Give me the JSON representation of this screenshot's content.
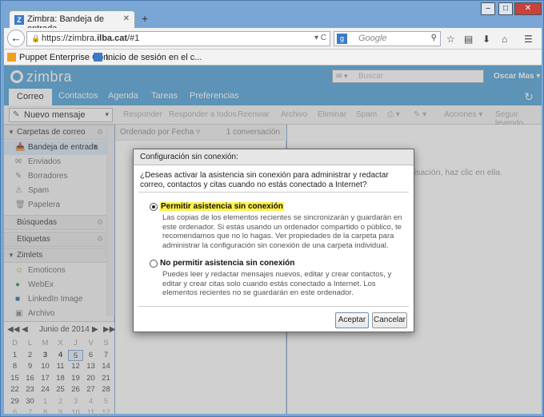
{
  "browser": {
    "tab_title": "Zimbra: Bandeja de entrada",
    "tab_close": "✕",
    "new_tab": "+",
    "url_prefix": "https://zimbra.",
    "url_domain": "ilba.cat",
    "url_suffix": "/#1",
    "url_controls": "▾ C",
    "search_placeholder": "Google",
    "window_controls": [
      "–",
      "□",
      "✕"
    ],
    "bookmarks": [
      "Puppet Enterprise Con...",
      "Inicio de sesión en el c..."
    ]
  },
  "zimbra": {
    "logo": "zimbra",
    "search_placeholder": "Buscar",
    "user": "Oscar Mas",
    "user_caret": "▾",
    "app_tabs": [
      "Correo",
      "Contactos",
      "Agenda",
      "Tareas",
      "Preferencias"
    ],
    "toolbar": {
      "new_message": "Nuevo mensaje",
      "actions": [
        "Responder",
        "Responder a todos",
        "Reenviar",
        "Archivo",
        "Eliminar",
        "Spam",
        "Acciones",
        "Seguir leyendo"
      ]
    },
    "sections": {
      "mail_folders": "Carpetas de correo",
      "searches": "Búsquedas",
      "tags": "Etiquetas",
      "zimlets": "Zimlets"
    },
    "folders": [
      "Bandeja de entrada",
      "Enviados",
      "Borradores",
      "Spam",
      "Papelera"
    ],
    "zimlets": [
      "Emoticons",
      "WebEx",
      "LinkedIn Image",
      "Archivo"
    ],
    "list": {
      "sort_label": "Ordenado por Fecha",
      "count": "1 conversación"
    },
    "reading_hint": "...isación, haz clic en ella."
  },
  "calendar": {
    "month": "Junio de 2014",
    "weekdays": [
      "D",
      "L",
      "M",
      "X",
      "J",
      "V",
      "S"
    ],
    "weeks": [
      [
        "1",
        "2",
        "3",
        "4",
        "5",
        "6",
        "7"
      ],
      [
        "8",
        "9",
        "10",
        "11",
        "12",
        "13",
        "14"
      ],
      [
        "15",
        "16",
        "17",
        "18",
        "19",
        "20",
        "21"
      ],
      [
        "22",
        "23",
        "24",
        "25",
        "26",
        "27",
        "28"
      ],
      [
        "29",
        "30",
        "1",
        "2",
        "3",
        "4",
        "5"
      ],
      [
        "6",
        "7",
        "8",
        "9",
        "10",
        "11",
        "12"
      ]
    ]
  },
  "dialog": {
    "title": "Configuración sin conexión:",
    "question": "¿Deseas activar la asistencia sin conexión para administrar y redactar correo, contactos y citas cuando no estás conectado a Internet?",
    "option_on": {
      "label": "Permitir asistencia sin conexión",
      "description": "Las copias de los elementos recientes se sincronizarán y guardarán en este ordenador. Si estás usando un ordenador compartido o público, te recomendamos que no lo hagas. Ver propiedades de la carpeta para administrar la configuración sin conexión de una carpeta individual."
    },
    "option_off": {
      "label": "No permitir asistencia sin conexión",
      "description": "Puedes leer y redactar mensajes nuevos, editar y crear contactos, y editar y crear citas solo cuando estás conectado a Internet. Los elementos recientes no se guardarán en este ordenador."
    },
    "accept": "Aceptar",
    "cancel": "Cancelar"
  }
}
